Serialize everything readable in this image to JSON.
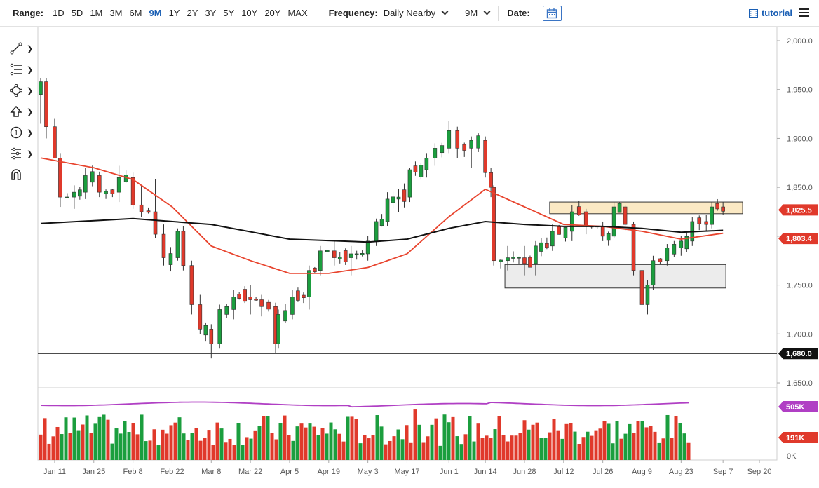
{
  "toolbar": {
    "range_label": "Range:",
    "ranges": [
      "1D",
      "5D",
      "1M",
      "3M",
      "6M",
      "9M",
      "1Y",
      "2Y",
      "3Y",
      "5Y",
      "10Y",
      "20Y",
      "MAX"
    ],
    "active_range": "9M",
    "frequency_label": "Frequency:",
    "frequency_value": "Daily Nearby",
    "period_value": "9M",
    "date_label": "Date:",
    "tutorial_label": "tutorial"
  },
  "drawing_tools": [
    "trendline-icon",
    "fib-icon",
    "shape-icon",
    "arrow-up-icon",
    "number-icon",
    "measure-icon",
    "magnet-icon"
  ],
  "colors": {
    "up": "#1b9e3e",
    "down": "#e0392b",
    "ma_fast": "#e8442e",
    "ma_slow": "#111111",
    "volume_avg": "#b03fc4",
    "resistance_zone": "#fbe9c4",
    "support_zone": "#ececec"
  },
  "chart_data": {
    "type": "candlestick",
    "price_axis": {
      "ticks": [
        "2,000.0",
        "1,950.0",
        "1,900.0",
        "1,850.0",
        "1,800.0",
        "1,750.0",
        "1,700.0",
        "1,650.0"
      ],
      "ylim": [
        1645,
        2000
      ]
    },
    "date_axis": {
      "ticks": [
        "Jan 11",
        "Jan 25",
        "Feb 8",
        "Feb 22",
        "Mar 8",
        "Mar 22",
        "Apr 5",
        "Apr 19",
        "May 3",
        "May 17",
        "Jun 1",
        "Jun 14",
        "Jun 28",
        "Jul 12",
        "Jul 26",
        "Aug 9",
        "Aug 23",
        "Sep 7",
        "Sep 20"
      ]
    },
    "price_tags": [
      {
        "label": "1,825.5",
        "value": 1825.5,
        "color": "#e0392b"
      },
      {
        "label": "1,803.4",
        "value": 1803.4,
        "color": "#e0392b"
      },
      {
        "label": "1,680.0",
        "value": 1680,
        "color": "#111111"
      }
    ],
    "horizontal_line": 1680,
    "zones": [
      {
        "name": "resistance",
        "from": "Jul 7",
        "to": "Sep 14",
        "low": 1823,
        "high": 1835
      },
      {
        "name": "support",
        "from": "Jun 21",
        "to": "Sep 8",
        "low": 1747,
        "high": 1771
      }
    ],
    "ohlc_keypoints": [
      [
        "Jan 6",
        1945,
        1962,
        1915,
        1958
      ],
      [
        "Jan 8",
        1958,
        1962,
        1900,
        1912
      ],
      [
        "Jan 11",
        1912,
        1920,
        1880,
        1880
      ],
      [
        "Jan 13",
        1880,
        1885,
        1830,
        1840
      ],
      [
        "Jan 18",
        1840,
        1852,
        1828,
        1845
      ],
      [
        "Jan 22",
        1845,
        1870,
        1838,
        1862
      ],
      [
        "Jan 27",
        1862,
        1866,
        1840,
        1845
      ],
      [
        "Feb 3",
        1845,
        1872,
        1835,
        1860
      ],
      [
        "Feb 8",
        1860,
        1865,
        1828,
        1832
      ],
      [
        "Feb 11",
        1832,
        1852,
        1820,
        1825
      ],
      [
        "Feb 16",
        1825,
        1858,
        1798,
        1802
      ],
      [
        "Feb 19",
        1802,
        1812,
        1770,
        1778
      ],
      [
        "Feb 24",
        1778,
        1808,
        1775,
        1805
      ],
      [
        "Feb 26",
        1805,
        1810,
        1765,
        1770
      ],
      [
        "Mar 1",
        1770,
        1775,
        1720,
        1730
      ],
      [
        "Mar 4",
        1730,
        1740,
        1700,
        1705
      ],
      [
        "Mar 8",
        1705,
        1710,
        1675,
        1690
      ],
      [
        "Mar 11",
        1690,
        1730,
        1685,
        1725
      ],
      [
        "Mar 16",
        1725,
        1745,
        1715,
        1738
      ],
      [
        "Mar 22",
        1738,
        1750,
        1720,
        1735
      ],
      [
        "Mar 26",
        1735,
        1740,
        1718,
        1728
      ],
      [
        "Mar 31",
        1728,
        1732,
        1680,
        1690
      ],
      [
        "Apr 1",
        1690,
        1725,
        1685,
        1720
      ],
      [
        "Apr 6",
        1720,
        1745,
        1715,
        1738
      ],
      [
        "Apr 12",
        1738,
        1770,
        1725,
        1765
      ],
      [
        "Apr 16",
        1765,
        1790,
        1760,
        1785
      ],
      [
        "Apr 21",
        1785,
        1795,
        1770,
        1778
      ],
      [
        "Apr 27",
        1778,
        1790,
        1760,
        1782
      ],
      [
        "May 3",
        1782,
        1800,
        1775,
        1795
      ],
      [
        "May 6",
        1795,
        1818,
        1790,
        1815
      ],
      [
        "May 10",
        1815,
        1845,
        1810,
        1838
      ],
      [
        "May 14",
        1838,
        1848,
        1825,
        1840
      ],
      [
        "May 18",
        1840,
        1870,
        1835,
        1868
      ],
      [
        "May 24",
        1868,
        1885,
        1860,
        1880
      ],
      [
        "May 27",
        1880,
        1895,
        1872,
        1890
      ],
      [
        "Jun 1",
        1890,
        1918,
        1885,
        1908
      ],
      [
        "Jun 4",
        1908,
        1912,
        1880,
        1890
      ],
      [
        "Jun 9",
        1890,
        1902,
        1870,
        1898
      ],
      [
        "Jun 14",
        1898,
        1902,
        1860,
        1865
      ],
      [
        "Jun 16",
        1865,
        1870,
        1840,
        1850
      ],
      [
        "Jun 17",
        1850,
        1852,
        1770,
        1775
      ],
      [
        "Jun 22",
        1775,
        1790,
        1765,
        1778
      ],
      [
        "Jun 28",
        1778,
        1790,
        1760,
        1772
      ],
      [
        "Jul 2",
        1772,
        1795,
        1760,
        1790
      ],
      [
        "Jul 8",
        1790,
        1812,
        1785,
        1805
      ],
      [
        "Jul 15",
        1805,
        1832,
        1795,
        1825
      ],
      [
        "Jul 20",
        1825,
        1828,
        1802,
        1810
      ],
      [
        "Jul 26",
        1810,
        1815,
        1795,
        1800
      ],
      [
        "Jul 30",
        1800,
        1835,
        1798,
        1830
      ],
      [
        "Aug 3",
        1830,
        1832,
        1805,
        1812
      ],
      [
        "Aug 6",
        1812,
        1815,
        1760,
        1765
      ],
      [
        "Aug 9",
        1765,
        1768,
        1678,
        1730
      ],
      [
        "Aug 11",
        1730,
        1755,
        1720,
        1750
      ],
      [
        "Aug 13",
        1750,
        1780,
        1745,
        1775
      ],
      [
        "Aug 18",
        1775,
        1792,
        1770,
        1788
      ],
      [
        "Aug 23",
        1788,
        1800,
        1780,
        1795
      ],
      [
        "Aug 27",
        1795,
        1820,
        1790,
        1815
      ],
      [
        "Sep 1",
        1815,
        1822,
        1805,
        1812
      ],
      [
        "Sep 3",
        1812,
        1835,
        1808,
        1830
      ],
      [
        "Sep 7",
        1830,
        1835,
        1822,
        1825.5
      ]
    ],
    "volume_axis": {
      "ticks": [
        "505K",
        "191K",
        "0K"
      ]
    },
    "volume_tags": [
      {
        "label": "505K",
        "color": "#b03fc4"
      },
      {
        "label": "191K",
        "color": "#e0392b"
      }
    ],
    "moving_averages": [
      {
        "color": "#e8442e",
        "points": [
          [
            "Jan 6",
            1880
          ],
          [
            "Jan 25",
            1870
          ],
          [
            "Feb 8",
            1858
          ],
          [
            "Feb 22",
            1830
          ],
          [
            "Mar 8",
            1790
          ],
          [
            "Mar 22",
            1775
          ],
          [
            "Apr 5",
            1762
          ],
          [
            "Apr 19",
            1762
          ],
          [
            "May 3",
            1768
          ],
          [
            "May 17",
            1782
          ],
          [
            "Jun 1",
            1820
          ],
          [
            "Jun 14",
            1848
          ],
          [
            "Jun 28",
            1830
          ],
          [
            "Jul 12",
            1812
          ],
          [
            "Jul 26",
            1810
          ],
          [
            "Aug 9",
            1805
          ],
          [
            "Aug 23",
            1797
          ],
          [
            "Sep 7",
            1803
          ]
        ]
      },
      {
        "color": "#111111",
        "points": [
          [
            "Jan 6",
            1813
          ],
          [
            "Feb 8",
            1818
          ],
          [
            "Mar 8",
            1812
          ],
          [
            "Apr 5",
            1797
          ],
          [
            "May 3",
            1794
          ],
          [
            "May 17",
            1797
          ],
          [
            "Jun 1",
            1808
          ],
          [
            "Jun 14",
            1815
          ],
          [
            "Jun 28",
            1812
          ],
          [
            "Jul 12",
            1810
          ],
          [
            "Jul 26",
            1810
          ],
          [
            "Aug 9",
            1808
          ],
          [
            "Aug 23",
            1804
          ],
          [
            "Sep 7",
            1806
          ]
        ]
      }
    ]
  }
}
